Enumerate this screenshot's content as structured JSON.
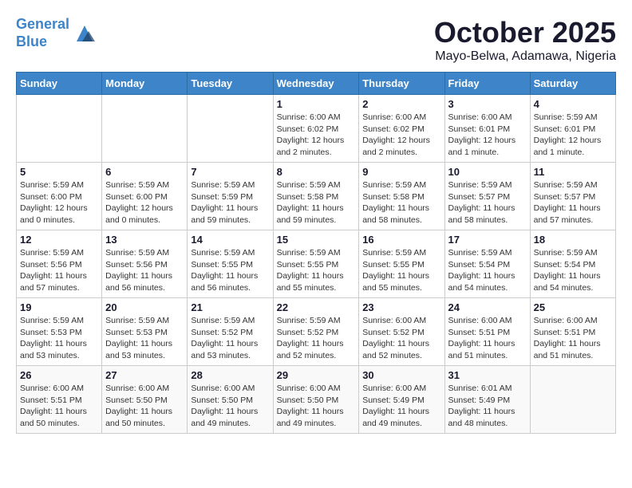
{
  "header": {
    "logo_line1": "General",
    "logo_line2": "Blue",
    "month": "October 2025",
    "location": "Mayo-Belwa, Adamawa, Nigeria"
  },
  "weekdays": [
    "Sunday",
    "Monday",
    "Tuesday",
    "Wednesday",
    "Thursday",
    "Friday",
    "Saturday"
  ],
  "weeks": [
    [
      {
        "day": "",
        "info": ""
      },
      {
        "day": "",
        "info": ""
      },
      {
        "day": "",
        "info": ""
      },
      {
        "day": "1",
        "info": "Sunrise: 6:00 AM\nSunset: 6:02 PM\nDaylight: 12 hours\nand 2 minutes."
      },
      {
        "day": "2",
        "info": "Sunrise: 6:00 AM\nSunset: 6:02 PM\nDaylight: 12 hours\nand 2 minutes."
      },
      {
        "day": "3",
        "info": "Sunrise: 6:00 AM\nSunset: 6:01 PM\nDaylight: 12 hours\nand 1 minute."
      },
      {
        "day": "4",
        "info": "Sunrise: 5:59 AM\nSunset: 6:01 PM\nDaylight: 12 hours\nand 1 minute."
      }
    ],
    [
      {
        "day": "5",
        "info": "Sunrise: 5:59 AM\nSunset: 6:00 PM\nDaylight: 12 hours\nand 0 minutes."
      },
      {
        "day": "6",
        "info": "Sunrise: 5:59 AM\nSunset: 6:00 PM\nDaylight: 12 hours\nand 0 minutes."
      },
      {
        "day": "7",
        "info": "Sunrise: 5:59 AM\nSunset: 5:59 PM\nDaylight: 11 hours\nand 59 minutes."
      },
      {
        "day": "8",
        "info": "Sunrise: 5:59 AM\nSunset: 5:58 PM\nDaylight: 11 hours\nand 59 minutes."
      },
      {
        "day": "9",
        "info": "Sunrise: 5:59 AM\nSunset: 5:58 PM\nDaylight: 11 hours\nand 58 minutes."
      },
      {
        "day": "10",
        "info": "Sunrise: 5:59 AM\nSunset: 5:57 PM\nDaylight: 11 hours\nand 58 minutes."
      },
      {
        "day": "11",
        "info": "Sunrise: 5:59 AM\nSunset: 5:57 PM\nDaylight: 11 hours\nand 57 minutes."
      }
    ],
    [
      {
        "day": "12",
        "info": "Sunrise: 5:59 AM\nSunset: 5:56 PM\nDaylight: 11 hours\nand 57 minutes."
      },
      {
        "day": "13",
        "info": "Sunrise: 5:59 AM\nSunset: 5:56 PM\nDaylight: 11 hours\nand 56 minutes."
      },
      {
        "day": "14",
        "info": "Sunrise: 5:59 AM\nSunset: 5:55 PM\nDaylight: 11 hours\nand 56 minutes."
      },
      {
        "day": "15",
        "info": "Sunrise: 5:59 AM\nSunset: 5:55 PM\nDaylight: 11 hours\nand 55 minutes."
      },
      {
        "day": "16",
        "info": "Sunrise: 5:59 AM\nSunset: 5:55 PM\nDaylight: 11 hours\nand 55 minutes."
      },
      {
        "day": "17",
        "info": "Sunrise: 5:59 AM\nSunset: 5:54 PM\nDaylight: 11 hours\nand 54 minutes."
      },
      {
        "day": "18",
        "info": "Sunrise: 5:59 AM\nSunset: 5:54 PM\nDaylight: 11 hours\nand 54 minutes."
      }
    ],
    [
      {
        "day": "19",
        "info": "Sunrise: 5:59 AM\nSunset: 5:53 PM\nDaylight: 11 hours\nand 53 minutes."
      },
      {
        "day": "20",
        "info": "Sunrise: 5:59 AM\nSunset: 5:53 PM\nDaylight: 11 hours\nand 53 minutes."
      },
      {
        "day": "21",
        "info": "Sunrise: 5:59 AM\nSunset: 5:52 PM\nDaylight: 11 hours\nand 53 minutes."
      },
      {
        "day": "22",
        "info": "Sunrise: 5:59 AM\nSunset: 5:52 PM\nDaylight: 11 hours\nand 52 minutes."
      },
      {
        "day": "23",
        "info": "Sunrise: 6:00 AM\nSunset: 5:52 PM\nDaylight: 11 hours\nand 52 minutes."
      },
      {
        "day": "24",
        "info": "Sunrise: 6:00 AM\nSunset: 5:51 PM\nDaylight: 11 hours\nand 51 minutes."
      },
      {
        "day": "25",
        "info": "Sunrise: 6:00 AM\nSunset: 5:51 PM\nDaylight: 11 hours\nand 51 minutes."
      }
    ],
    [
      {
        "day": "26",
        "info": "Sunrise: 6:00 AM\nSunset: 5:51 PM\nDaylight: 11 hours\nand 50 minutes."
      },
      {
        "day": "27",
        "info": "Sunrise: 6:00 AM\nSunset: 5:50 PM\nDaylight: 11 hours\nand 50 minutes."
      },
      {
        "day": "28",
        "info": "Sunrise: 6:00 AM\nSunset: 5:50 PM\nDaylight: 11 hours\nand 49 minutes."
      },
      {
        "day": "29",
        "info": "Sunrise: 6:00 AM\nSunset: 5:50 PM\nDaylight: 11 hours\nand 49 minutes."
      },
      {
        "day": "30",
        "info": "Sunrise: 6:00 AM\nSunset: 5:49 PM\nDaylight: 11 hours\nand 49 minutes."
      },
      {
        "day": "31",
        "info": "Sunrise: 6:01 AM\nSunset: 5:49 PM\nDaylight: 11 hours\nand 48 minutes."
      },
      {
        "day": "",
        "info": ""
      }
    ]
  ]
}
